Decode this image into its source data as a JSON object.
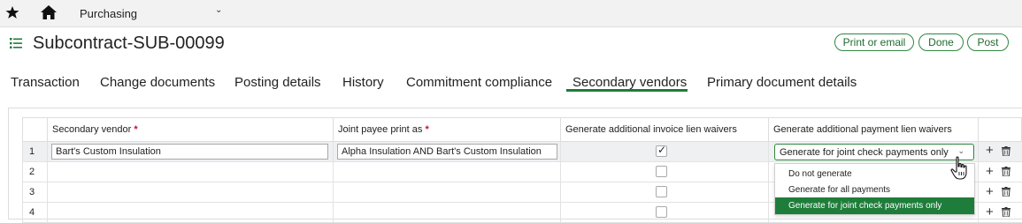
{
  "nav": {
    "module_label": "Purchasing",
    "icons": {
      "favorite": "star-icon",
      "home": "home-icon",
      "module_dropdown": "chevron-down-icon"
    }
  },
  "header": {
    "title": "Subcontract-SUB-00099",
    "buttons": {
      "print_email": "Print or email",
      "done": "Done",
      "post": "Post"
    },
    "accent_color": "#1e7d3a"
  },
  "tabs": [
    {
      "label": "Transaction",
      "active": false
    },
    {
      "label": "Change documents",
      "active": false
    },
    {
      "label": "Posting details",
      "active": false
    },
    {
      "label": "History",
      "active": false
    },
    {
      "label": "Commitment compliance",
      "active": false
    },
    {
      "label": "Secondary vendors",
      "active": true
    },
    {
      "label": "Primary document details",
      "active": false
    }
  ],
  "grid": {
    "columns": {
      "secondary_vendor": "Secondary vendor",
      "joint_payee": "Joint payee print as",
      "invoice_lien": "Generate additional invoice lien waivers",
      "payment_lien": "Generate additional payment lien waivers"
    },
    "required_marker": "*",
    "rows": [
      {
        "num": "1",
        "secondary_vendor": "Bart's Custom Insulation",
        "joint_payee": "Alpha Insulation AND Bart's Custom Insulation",
        "invoice_lien_checked": true,
        "payment_lien": "Generate for joint check payments only"
      },
      {
        "num": "2",
        "secondary_vendor": "",
        "joint_payee": "",
        "invoice_lien_checked": false
      },
      {
        "num": "3",
        "secondary_vendor": "",
        "joint_payee": "",
        "invoice_lien_checked": false
      },
      {
        "num": "4",
        "secondary_vendor": "",
        "joint_payee": "",
        "invoice_lien_checked": false
      }
    ],
    "dropdown_options": [
      {
        "label": "Do not generate",
        "selected": false
      },
      {
        "label": "Generate for all payments",
        "selected": false
      },
      {
        "label": "Generate for joint check payments only",
        "selected": true
      }
    ],
    "row_actions": {
      "add": "+",
      "delete_icon": "trash-icon"
    }
  }
}
